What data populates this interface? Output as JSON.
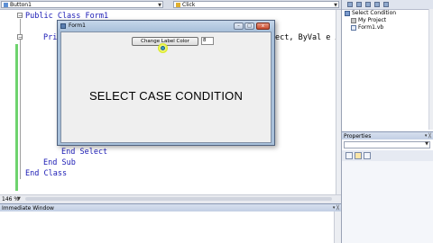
{
  "editor": {
    "object_combo": "Button1",
    "event_combo": "Click",
    "lines": {
      "class_decl": "Public Class Form1",
      "sub_decl_start": "Pri",
      "sub_decl_end": "ect, ByVal e A",
      "end_select": "End Select",
      "end_sub": "End Sub",
      "end_class": "End Class"
    },
    "zoom": "146 %"
  },
  "form_window": {
    "title": "Form1",
    "change_button_label": "Change Label Color",
    "input_value": "8",
    "label_text": "SELECT CASE CONDITION",
    "title_buttons": {
      "minimize": "–",
      "maximize": "□",
      "close": "x"
    }
  },
  "solution_explorer": {
    "items": [
      {
        "label": "Select Condition",
        "icon": "solution-icon"
      },
      {
        "label": "My Project",
        "icon": "project-icon"
      },
      {
        "label": "Form1.vb",
        "icon": "vb-file-icon"
      }
    ]
  },
  "properties": {
    "title": "Properties",
    "pin": "▾ ╳"
  },
  "immediate": {
    "title": "Immediate Window",
    "controls": "▾ ╳"
  },
  "colors": {
    "ide_background": "#d8dde7",
    "keyword": "#1a1ab5",
    "gutter_changed": "#6ed36e",
    "form_client": "#efefef"
  }
}
